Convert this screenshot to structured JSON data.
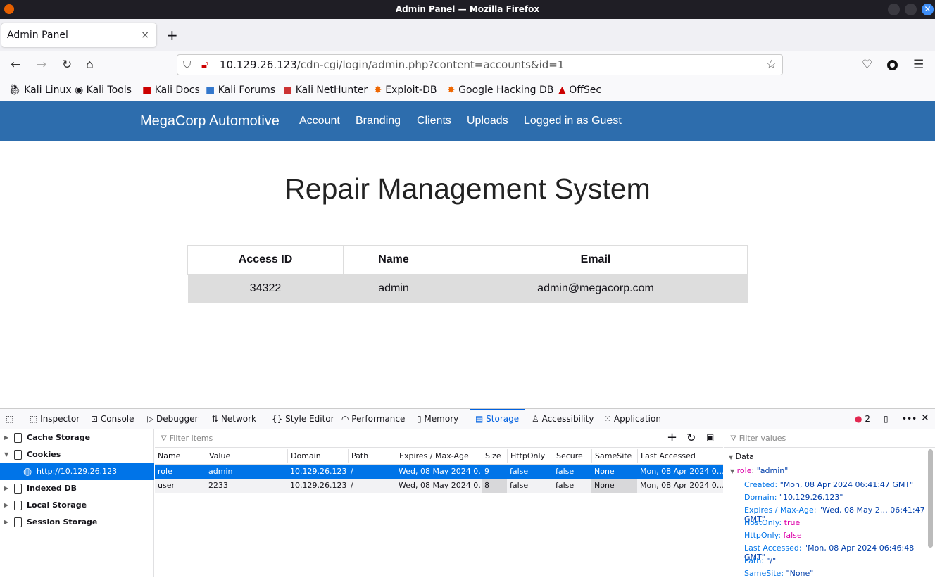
{
  "window": {
    "title": "Admin Panel — Mozilla Firefox"
  },
  "tab": {
    "title": "Admin Panel",
    "close": "×",
    "new": "+"
  },
  "url": {
    "host": "10.129.26.123",
    "path": "/cdn-cgi/login/admin.php?content=accounts&id=1"
  },
  "bookmarks": [
    "Kali Linux",
    "Kali Tools",
    "Kali Docs",
    "Kali Forums",
    "Kali NetHunter",
    "Exploit-DB",
    "Google Hacking DB",
    "OffSec"
  ],
  "site": {
    "brand": "MegaCorp Automotive",
    "nav": [
      "Account",
      "Branding",
      "Clients",
      "Uploads",
      "Logged in as Guest"
    ],
    "heading": "Repair Management System",
    "table": {
      "headers": [
        "Access ID",
        "Name",
        "Email"
      ],
      "rows": [
        [
          "34322",
          "admin",
          "admin@megacorp.com"
        ]
      ]
    }
  },
  "devtools": {
    "tabs": [
      "Inspector",
      "Console",
      "Debugger",
      "Network",
      "Style Editor",
      "Performance",
      "Memory",
      "Storage",
      "Accessibility",
      "Application"
    ],
    "active_tab": "Storage",
    "error_count": "2",
    "sidebar": [
      "Cache Storage",
      "Cookies",
      "http://10.129.26.123",
      "Indexed DB",
      "Local Storage",
      "Session Storage"
    ],
    "filter_items": "Filter Items",
    "filter_values": "Filter values",
    "columns": [
      "Name",
      "Value",
      "Domain",
      "Path",
      "Expires / Max-Age",
      "Size",
      "HttpOnly",
      "Secure",
      "SameSite",
      "Last Accessed"
    ],
    "cookies": [
      [
        "role",
        "admin",
        "10.129.26.123",
        "/",
        "Wed, 08 May 2024 0…",
        "9",
        "false",
        "false",
        "None",
        "Mon, 08 Apr 2024 0…"
      ],
      [
        "user",
        "2233",
        "10.129.26.123",
        "/",
        "Wed, 08 May 2024 0…",
        "8",
        "false",
        "false",
        "None",
        "Mon, 08 Apr 2024 0…"
      ]
    ],
    "data_header": "Data",
    "data_key": "role",
    "data_value": "\"admin\"",
    "details": [
      [
        "Created",
        "\"Mon, 08 Apr 2024 06:41:47 GMT\""
      ],
      [
        "Domain",
        "\"10.129.26.123\""
      ],
      [
        "Expires / Max-Age",
        "\"Wed, 08 May 2… 06:41:47 GMT\""
      ],
      [
        "HostOnly",
        "true"
      ],
      [
        "HttpOnly",
        "false"
      ],
      [
        "Last Accessed",
        "\"Mon, 08 Apr 2024 06:46:48 GMT\""
      ],
      [
        "Path",
        "\"/\""
      ],
      [
        "SameSite",
        "\"None\""
      ]
    ]
  },
  "colors": {
    "site_nav": "#2d6dad",
    "selection": "#0074e8",
    "accent": "#0061e0"
  }
}
